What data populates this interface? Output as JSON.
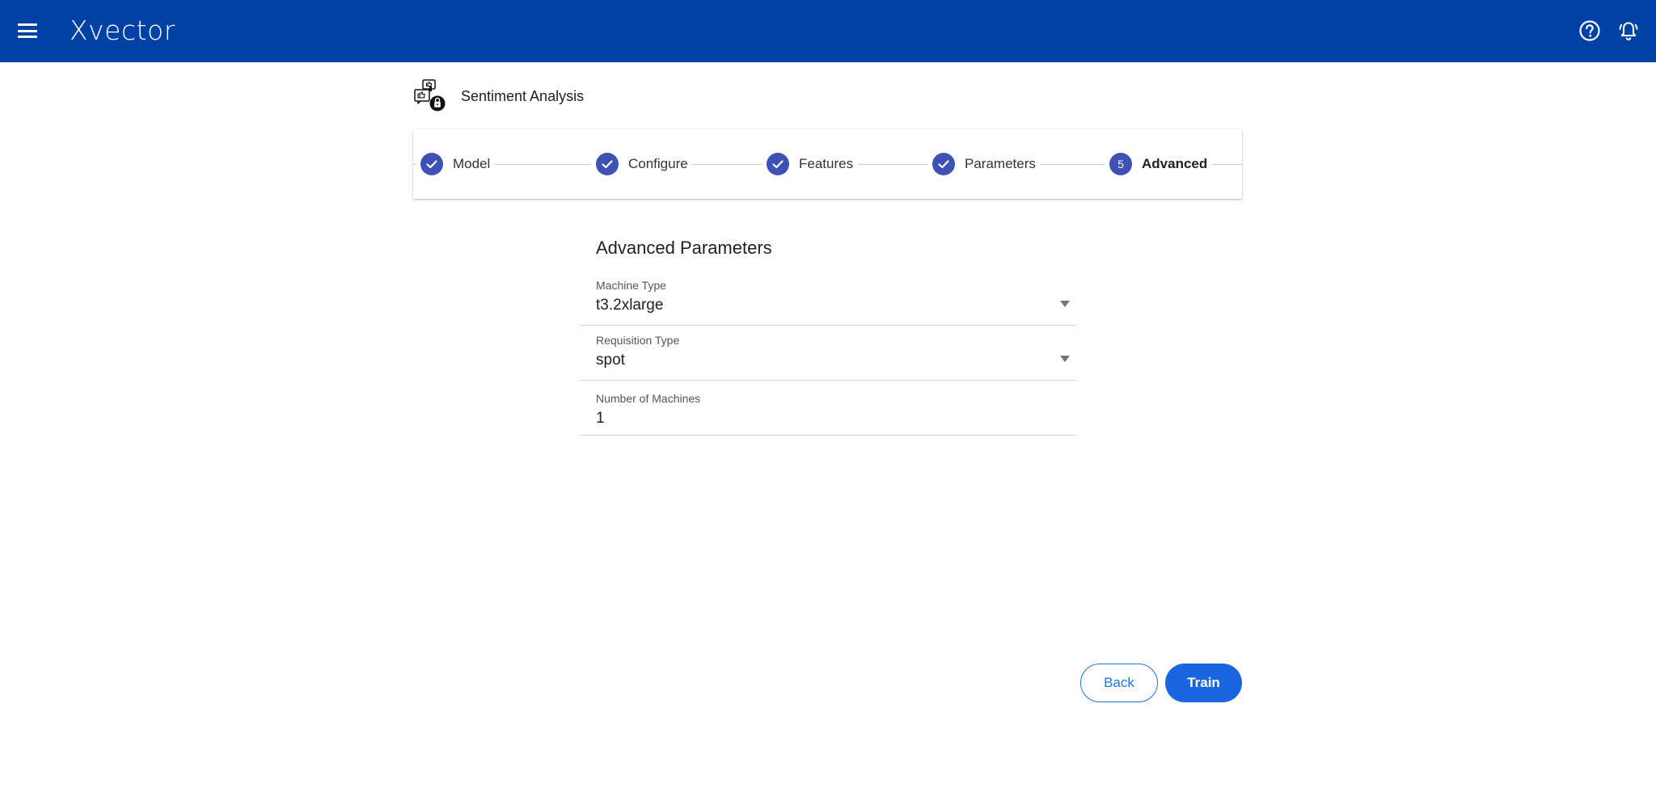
{
  "app": {
    "logo_text": "Xvector",
    "brand_color": "#0041a6"
  },
  "header_icons": [
    "menu-icon",
    "help-icon",
    "notification-bell-icon"
  ],
  "project": {
    "title": "Sentiment Analysis",
    "icon": "sentiment-analysis-icon"
  },
  "stepper": {
    "accent_color": "#3f51b5",
    "steps": [
      {
        "label": "Model",
        "state": "completed",
        "icon": "check-icon"
      },
      {
        "label": "Configure",
        "state": "completed",
        "icon": "check-icon"
      },
      {
        "label": "Features",
        "state": "completed",
        "icon": "check-icon"
      },
      {
        "label": "Parameters",
        "state": "completed",
        "icon": "check-icon"
      },
      {
        "label": "Advanced",
        "state": "active",
        "number": "5"
      }
    ]
  },
  "form": {
    "title": "Advanced Parameters",
    "machine_type": {
      "label": "Machine Type",
      "value": "t3.2xlarge"
    },
    "requisition_type": {
      "label": "Requisition Type",
      "value": "spot"
    },
    "number_of_machines": {
      "label": "Number of Machines",
      "value": "1"
    }
  },
  "actions": {
    "back_label": "Back",
    "train_label": "Train",
    "primary_color": "#1a66e0"
  }
}
